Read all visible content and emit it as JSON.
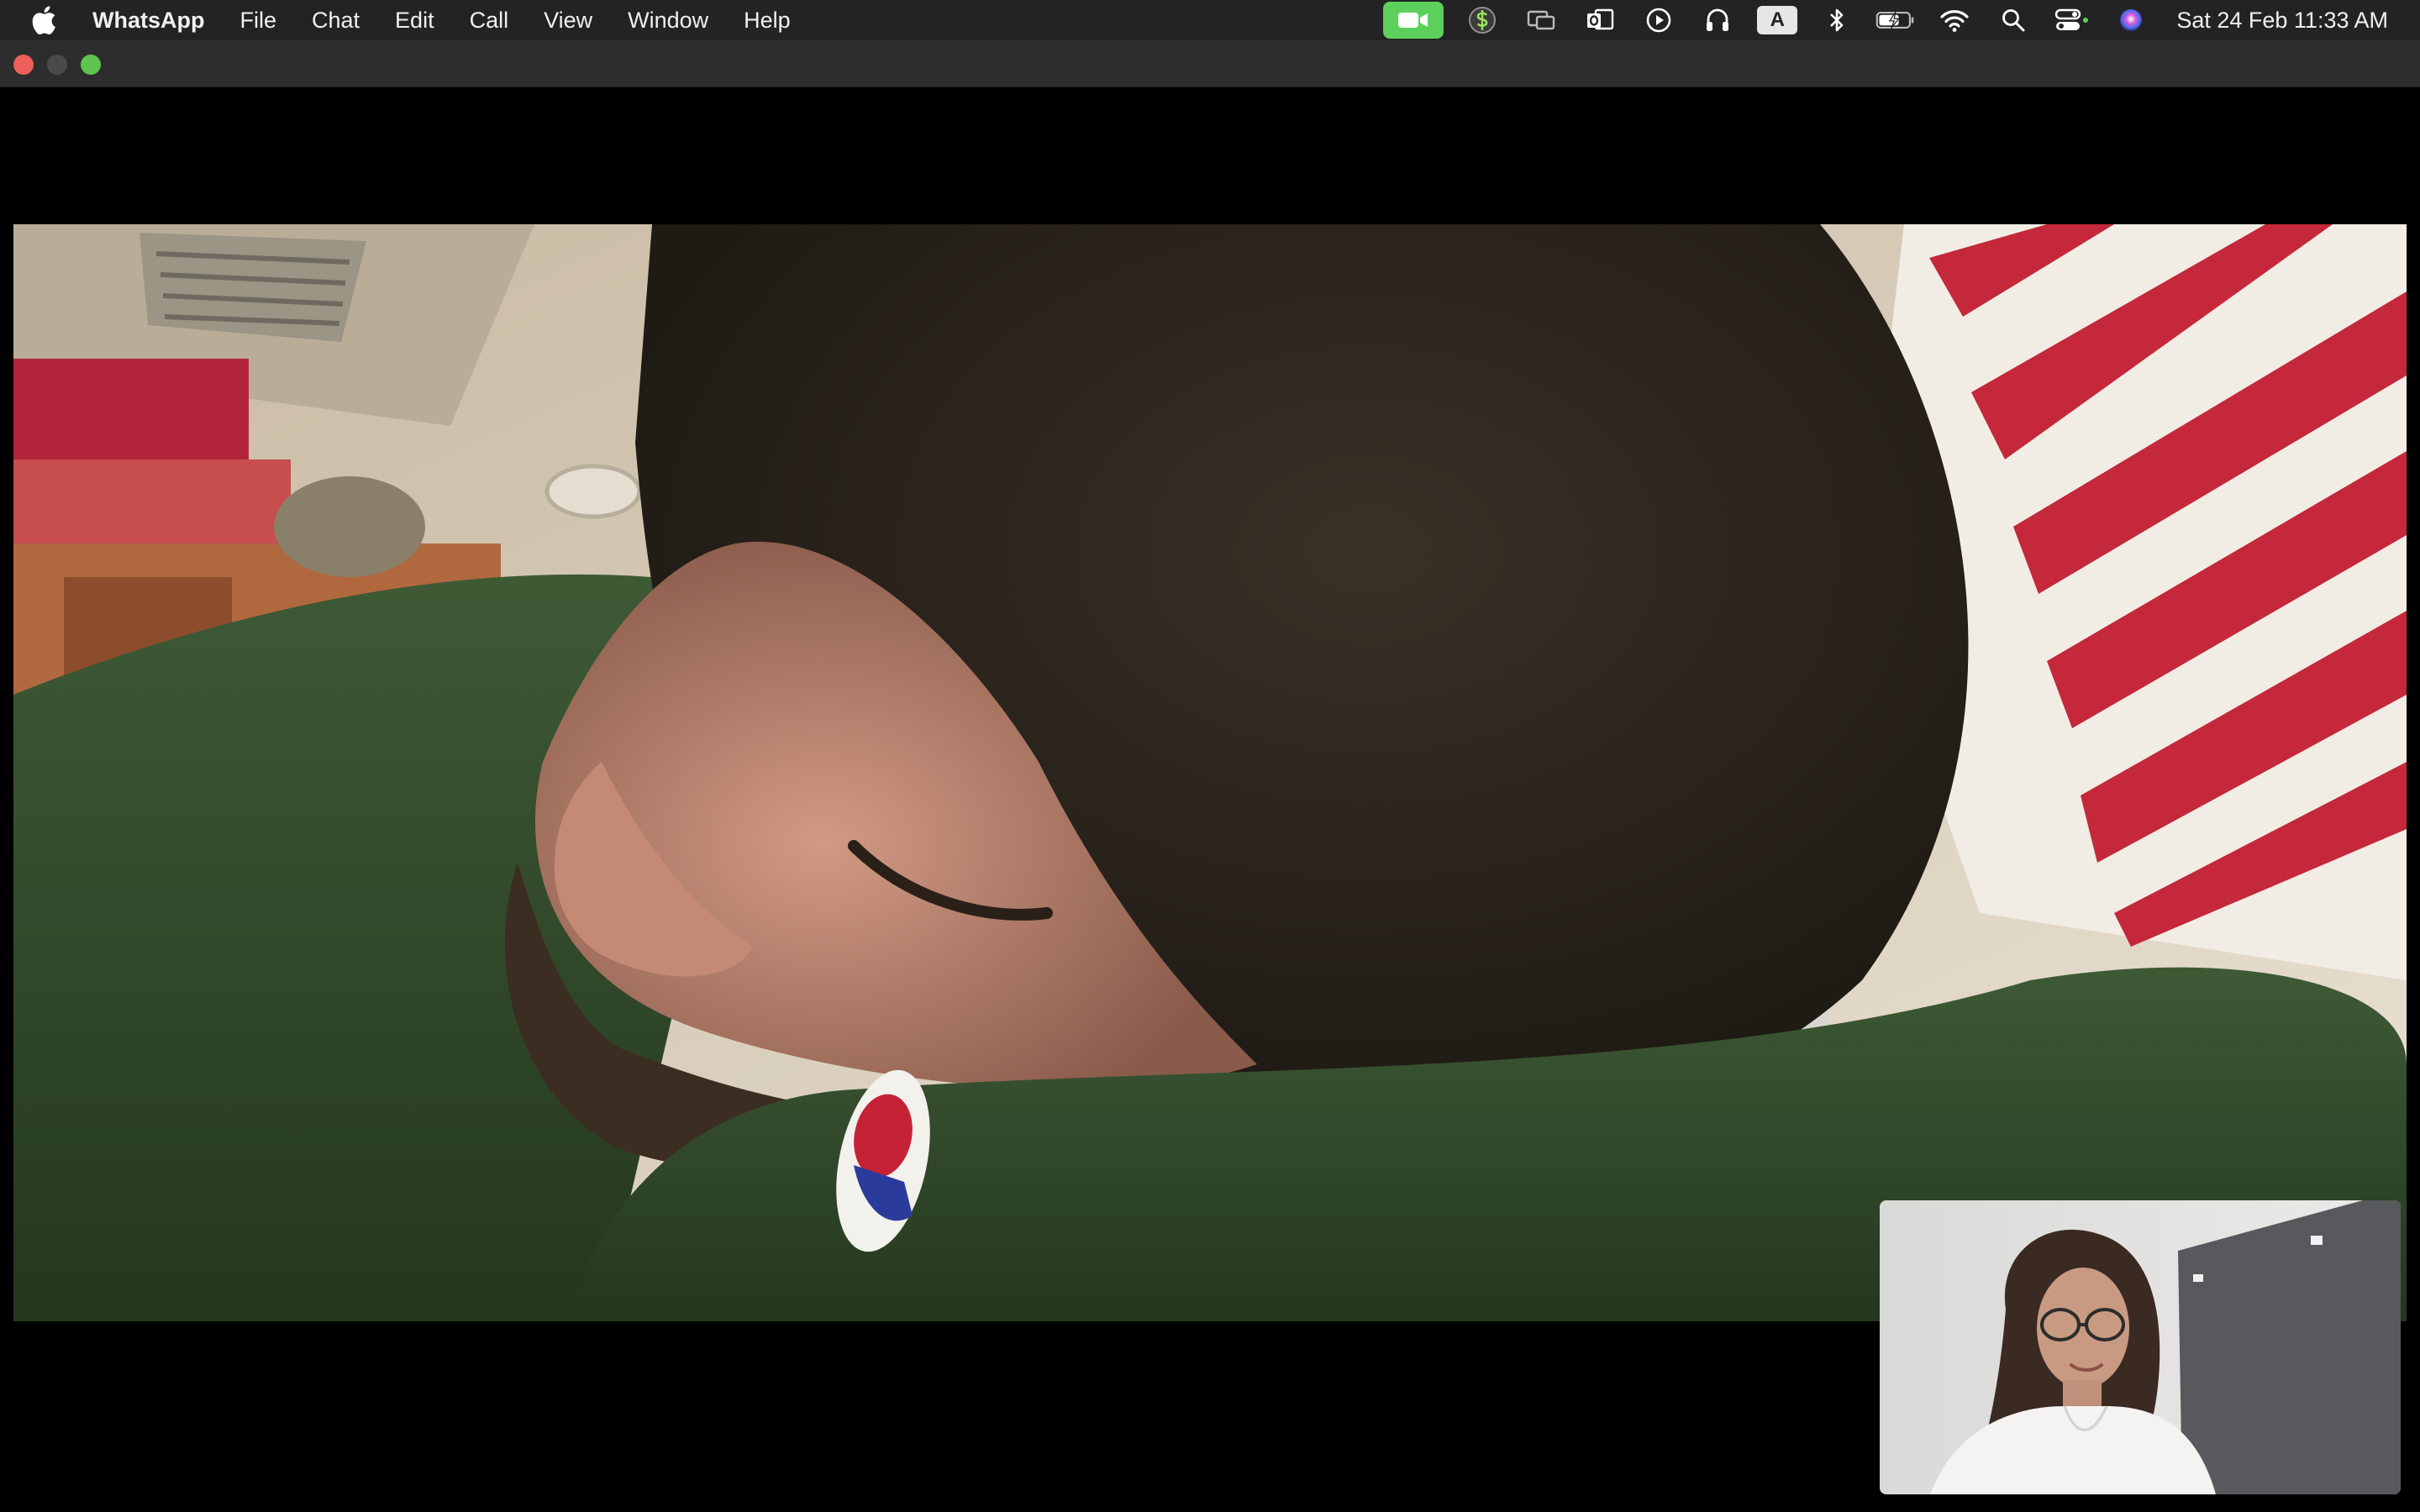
{
  "menubar": {
    "apple_icon": "apple-icon",
    "app_name": "WhatsApp",
    "menus": [
      "File",
      "Chat",
      "Edit",
      "Call",
      "View",
      "Window",
      "Help"
    ],
    "status_icons": [
      "video-camera-icon",
      "dollar-sync-icon",
      "screen-mirror-icon",
      "outlook-icon",
      "play-circle-icon",
      "headphones-icon",
      "keyboard-input-icon",
      "bluetooth-icon",
      "battery-charging-icon",
      "wifi-icon",
      "search-icon",
      "control-center-icon",
      "siri-icon"
    ],
    "keyboard_input_label": "A",
    "clock": "Sat 24 Feb  11:33 AM",
    "video_indicator_color": "#5bd15b"
  },
  "window": {
    "traffic_lights": [
      "close",
      "minimize",
      "zoom"
    ]
  },
  "call": {
    "remote_video": "remote-participant-video",
    "self_video": "self-view-video"
  }
}
